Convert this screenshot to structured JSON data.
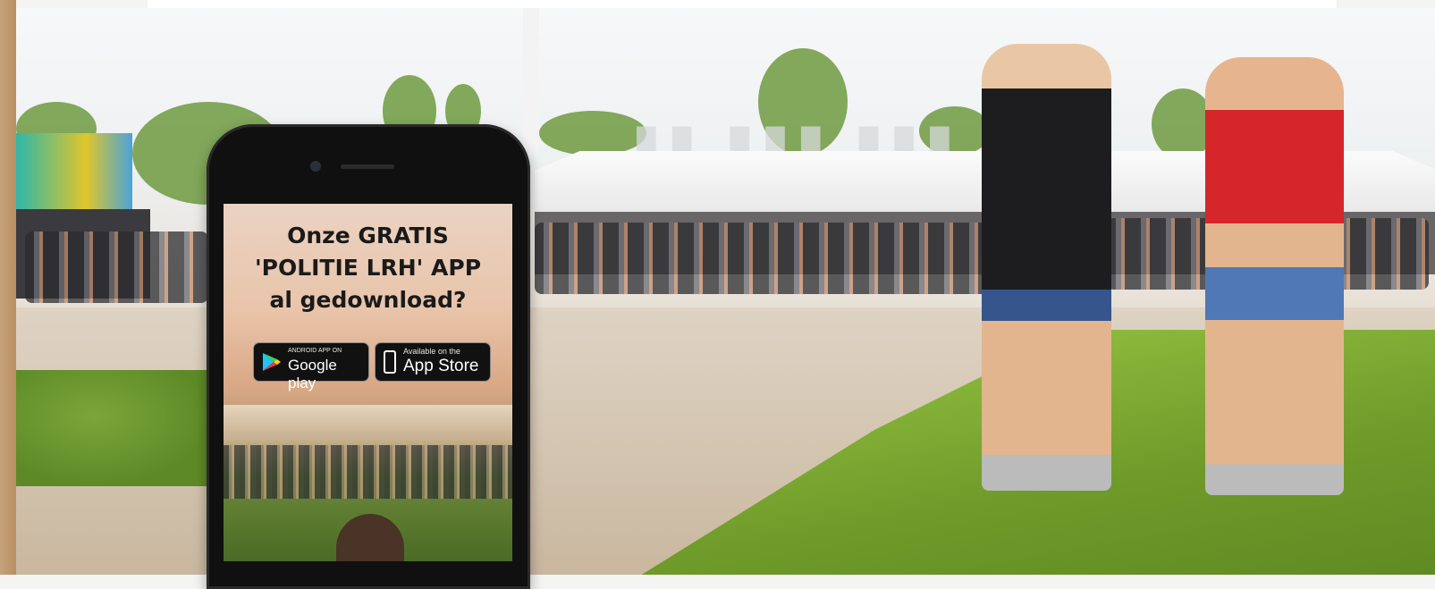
{
  "promo": {
    "title_line_1": "Onze GRATIS",
    "title_line_2": "'POLITIE LRH' APP",
    "title_line_3": "al gedownload?"
  },
  "badges": {
    "google": {
      "small": "ANDROID APP ON",
      "big": "Google play",
      "icon": "google-play-icon"
    },
    "apple": {
      "small": "Available on the",
      "big": "App Store",
      "icon": "phone-icon"
    }
  },
  "colors": {
    "badge_bg": "#111111",
    "grass": "#7aa63a",
    "sand": "#d6c7b2"
  }
}
